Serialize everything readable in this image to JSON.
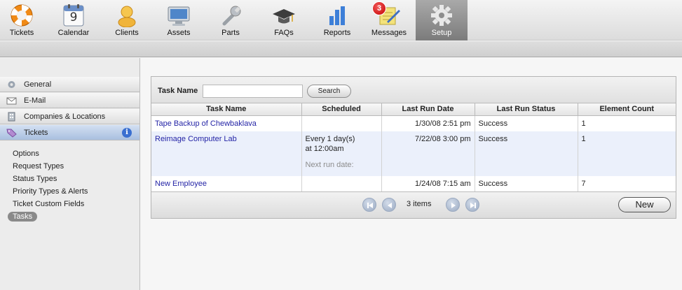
{
  "toolbar": {
    "items": [
      {
        "label": "Tickets",
        "icon": "lifebuoy-icon"
      },
      {
        "label": "Calendar",
        "icon": "calendar-icon",
        "calendar_day": "9"
      },
      {
        "label": "Clients",
        "icon": "person-icon"
      },
      {
        "label": "Assets",
        "icon": "monitor-icon"
      },
      {
        "label": "Parts",
        "icon": "wrench-icon"
      },
      {
        "label": "FAQs",
        "icon": "graduation-cap-icon"
      },
      {
        "label": "Reports",
        "icon": "bar-chart-icon"
      },
      {
        "label": "Messages",
        "icon": "note-pencil-icon",
        "badge": "3"
      },
      {
        "label": "Setup",
        "icon": "gear-icon",
        "active": true
      }
    ]
  },
  "sidebar": {
    "sections": [
      {
        "label": "General",
        "icon": "gear-icon"
      },
      {
        "label": "E-Mail",
        "icon": "envelope-icon"
      },
      {
        "label": "Companies & Locations",
        "icon": "building-icon"
      },
      {
        "label": "Tickets",
        "icon": "tag-icon",
        "active": true,
        "info_icon": "i"
      }
    ],
    "links": [
      {
        "label": "Options"
      },
      {
        "label": "Request Types"
      },
      {
        "label": "Status Types"
      },
      {
        "label": "Priority Types & Alerts"
      },
      {
        "label": "Ticket Custom Fields"
      },
      {
        "label": "Tasks",
        "selected": true
      }
    ]
  },
  "search": {
    "label": "Task Name",
    "value": "",
    "placeholder": "",
    "button_label": "Search"
  },
  "table": {
    "headers": [
      "Task Name",
      "Scheduled",
      "Last Run Date",
      "Last Run Status",
      "Element Count"
    ],
    "rows": [
      {
        "name": "Tape Backup of Chewbaklava",
        "scheduled_line1": "",
        "scheduled_line2": "",
        "next_run": "",
        "last_run_date": "1/30/08 2:51 pm",
        "status": "Success",
        "count": "1"
      },
      {
        "name": "Reimage Computer Lab",
        "scheduled_line1": "Every 1 day(s)",
        "scheduled_line2": "at 12:00am",
        "next_run": "Next run date:",
        "last_run_date": "7/22/08 3:00 pm",
        "status": "Success",
        "count": "1"
      },
      {
        "name": "New Employee",
        "scheduled_line1": "",
        "scheduled_line2": "",
        "next_run": "",
        "last_run_date": "1/24/08 7:15 am",
        "status": "Success",
        "count": "7"
      }
    ]
  },
  "pager": {
    "count_label": "3 items",
    "new_label": "New"
  }
}
